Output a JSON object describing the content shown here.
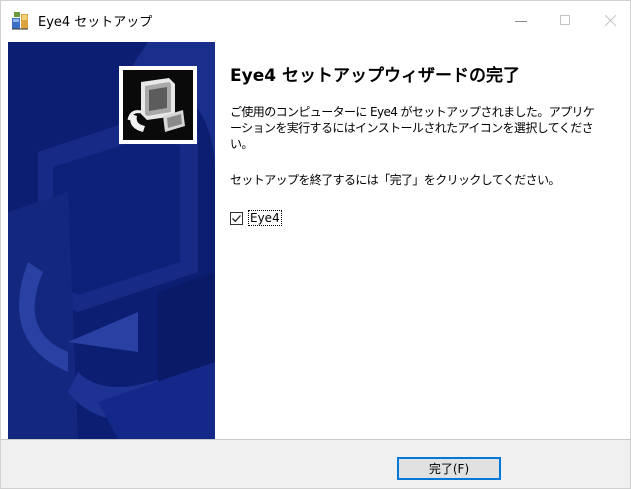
{
  "window": {
    "title": "Eye4 セットアップ",
    "controls": {
      "minimize_icon": "minimize-icon",
      "maximize_icon": "maximize-icon",
      "close_icon": "close-icon"
    }
  },
  "banner": {
    "background_color": "#0c1e72",
    "icon": "setup-computer-icon"
  },
  "content": {
    "heading": "Eye4 セットアップウィザードの完了",
    "paragraph1_line1": "ご使用のコンピューターに Eye4 がセットアップされました。アプリケ",
    "paragraph1_line2": "ーションを実行するにはインストールされたアイコンを選択してくださ",
    "paragraph1_line3": "い。",
    "paragraph2": "セットアップを終了するには「完了」をクリックしてください。",
    "launch_checkbox": {
      "label": "Eye4",
      "checked": true
    }
  },
  "footer": {
    "finish_button_label": "完了(F)"
  },
  "colors": {
    "accent_border": "#0078d7",
    "footer_bg": "#f0f0f0"
  }
}
